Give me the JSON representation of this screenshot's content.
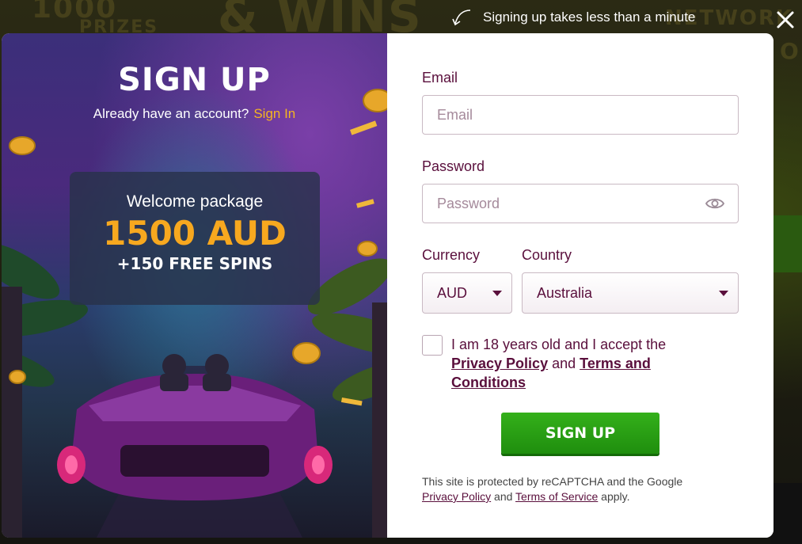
{
  "background": {
    "text_1": "1000",
    "text_2": "PRIZES",
    "text_3": "& WINS",
    "text_4": "NETWORK",
    "text_5": "OP"
  },
  "hint": {
    "text": "Signing up takes less than a minute"
  },
  "promo": {
    "title": "SIGN UP",
    "account_prompt": "Already have an account?",
    "signin_link": "Sign In",
    "bonus_label": "Welcome package",
    "bonus_amount": "1500 AUD",
    "bonus_spins": "+150 FREE SPINS"
  },
  "form": {
    "email_label": "Email",
    "email_placeholder": "Email",
    "email_value": "",
    "password_label": "Password",
    "password_placeholder": "Password",
    "password_value": "",
    "currency_label": "Currency",
    "currency_value": "AUD",
    "country_label": "Country",
    "country_value": "Australia",
    "terms_text_1": "I am 18 years old and I accept the",
    "terms_link_privacy": "Privacy Policy",
    "terms_and": "and",
    "terms_link_conditions": "Terms and Conditions",
    "signup_button": "SIGN UP",
    "recaptcha_text": "This site is protected by reCAPTCHA and the Google",
    "recaptcha_privacy": "Privacy Policy",
    "recaptcha_and": "and",
    "recaptcha_terms": "Terms of Service",
    "recaptcha_apply": "apply."
  },
  "colors": {
    "brand_text": "#5a0f3c",
    "accent_gold": "#f7a81f",
    "button_green": "#2aa016"
  },
  "icons": {
    "close": "close-icon",
    "eye": "eye-icon",
    "arrow": "curved-arrow-icon"
  }
}
